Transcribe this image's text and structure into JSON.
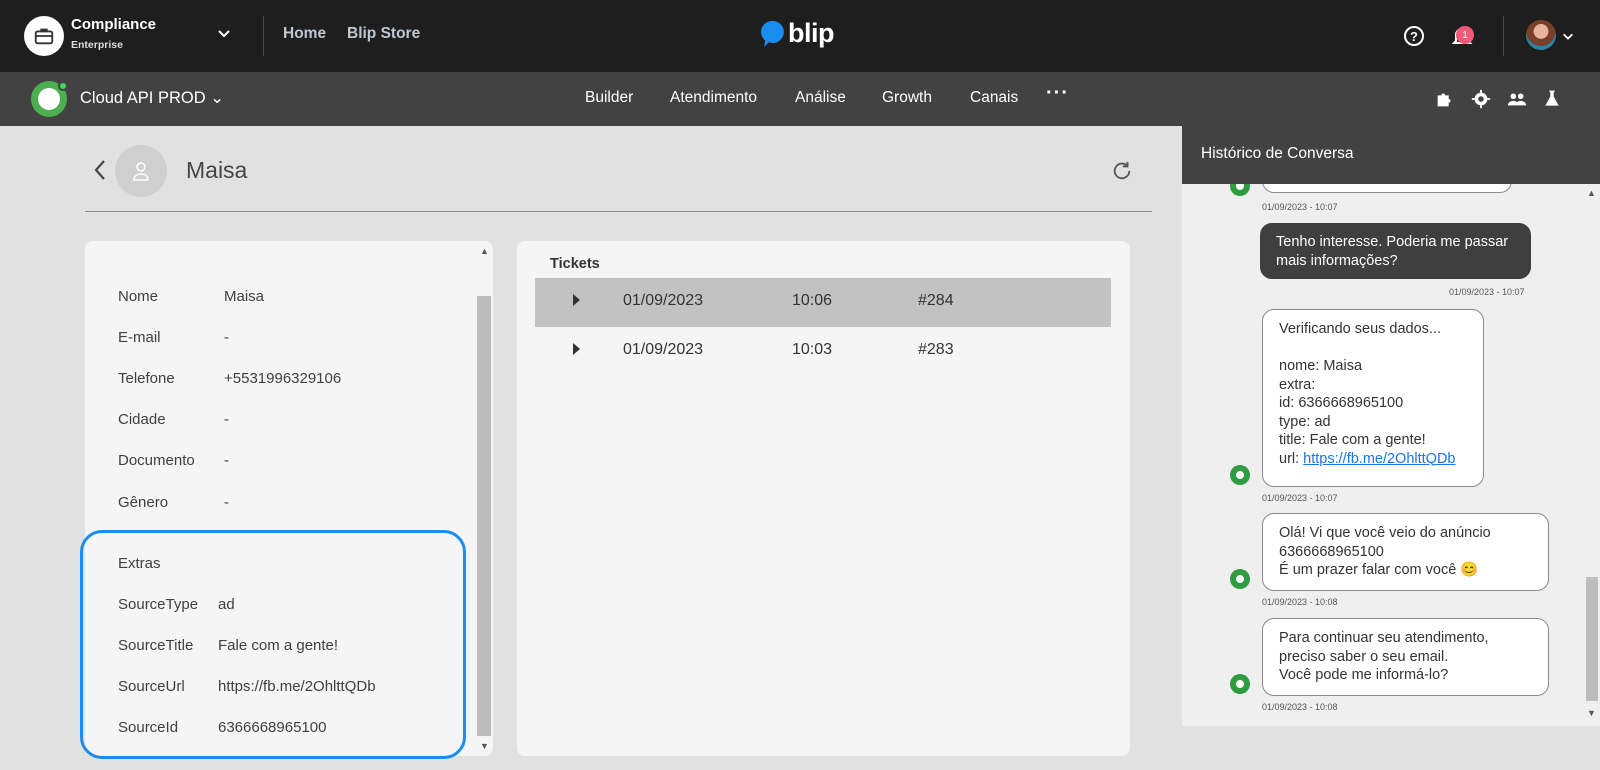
{
  "topbar": {
    "org_name": "Compliance",
    "org_plan": "Enterprise",
    "links": [
      "Home",
      "Blip Store"
    ],
    "brand": "blip",
    "notification_count": "1"
  },
  "subbar": {
    "bot_name": "Cloud API PROD",
    "nav": [
      "Builder",
      "Atendimento",
      "Análise",
      "Growth",
      "Canais"
    ],
    "more": "···"
  },
  "contact": {
    "name": "Maisa",
    "fields": [
      {
        "label": "Nome",
        "value": "Maisa"
      },
      {
        "label": "E-mail",
        "value": "-"
      },
      {
        "label": "Telefone",
        "value": "+5531996329106"
      },
      {
        "label": "Cidade",
        "value": "-"
      },
      {
        "label": "Documento",
        "value": "-"
      },
      {
        "label": "Gênero",
        "value": "-"
      }
    ],
    "extras_title": "Extras",
    "extras": [
      {
        "label": "SourceType",
        "value": "ad"
      },
      {
        "label": "SourceTitle",
        "value": "Fale com a gente!"
      },
      {
        "label": "SourceUrl",
        "value": "https://fb.me/2OhlttQDb"
      },
      {
        "label": "SourceId",
        "value": "6366668965100"
      }
    ]
  },
  "tickets": {
    "title": "Tickets",
    "rows": [
      {
        "date": "01/09/2023",
        "time": "10:06",
        "id": "#284",
        "selected": true
      },
      {
        "date": "01/09/2023",
        "time": "10:03",
        "id": "#283",
        "selected": false
      }
    ]
  },
  "history": {
    "title": "Histórico de Conversa",
    "messages": [
      {
        "from": "bot",
        "text": "",
        "time": "01/09/2023 - 10:07"
      },
      {
        "from": "user",
        "text": "Tenho interesse. Poderia me passar\nmais informações?",
        "time": "01/09/2023 - 10:07"
      },
      {
        "from": "bot",
        "text": "Verificando seus dados...\n\nnome: Maisa\nextra:\nid: 6366668965100\ntype: ad\ntitle: Fale com a gente!\nurl: ",
        "link": "https://fb.me/2OhlttQDb",
        "time": "01/09/2023 - 10:07"
      },
      {
        "from": "bot",
        "text": "Olá! Vi que você veio do anúncio\n6366668965100\nÉ um prazer falar com você 😊",
        "time": "01/09/2023 - 10:08"
      },
      {
        "from": "bot",
        "text": "Para continuar seu atendimento,\npreciso saber o seu email.\nVocê pode me informá-lo?",
        "time": "01/09/2023 - 10:08"
      }
    ]
  },
  "colors": {
    "topbar": "#1e1e1e",
    "subbar": "#424242",
    "accent_blue": "#1a8ef0",
    "bot_green": "#2e9c3f",
    "badge": "#f05a78"
  }
}
